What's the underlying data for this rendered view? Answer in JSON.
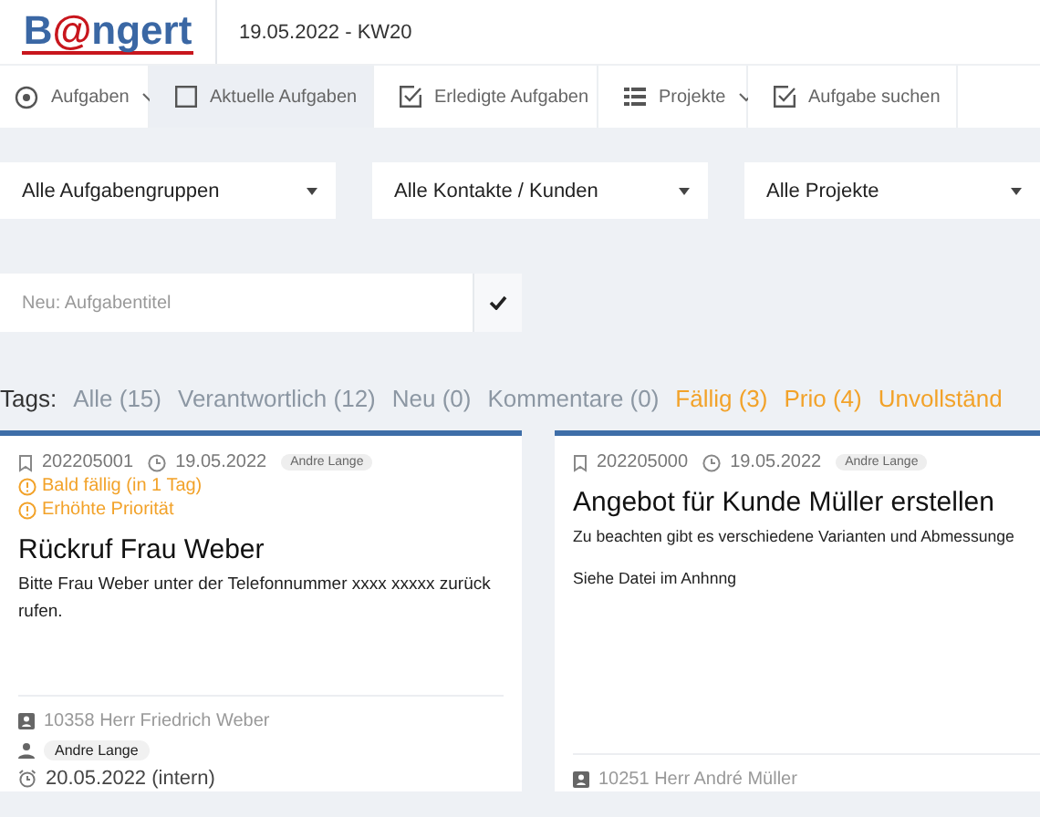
{
  "header": {
    "logo": [
      {
        "text": "B",
        "kind": "plain"
      },
      {
        "text": "@",
        "kind": "accent"
      },
      {
        "text": "ngert",
        "kind": "plain"
      }
    ],
    "date": "19.05.2022 - KW20"
  },
  "nav": [
    {
      "label": "Aufgaben",
      "kind": "radio",
      "dropdown": true,
      "selected": false
    },
    {
      "label": "Aktuelle Aufgaben",
      "kind": "box",
      "dropdown": false,
      "selected": true
    },
    {
      "label": "Erledigte Aufgaben",
      "kind": "check",
      "dropdown": false,
      "selected": false
    },
    {
      "label": "Projekte",
      "kind": "list",
      "dropdown": true,
      "selected": false
    },
    {
      "label": "Aufgabe suchen",
      "kind": "check",
      "dropdown": false,
      "selected": false
    }
  ],
  "filters": [
    {
      "value": "Alle Aufgabengruppen"
    },
    {
      "value": "Alle Kontakte / Kunden"
    },
    {
      "value": "Alle Projekte"
    }
  ],
  "new_task": {
    "placeholder": "Neu: Aufgabentitel"
  },
  "tags": {
    "label": "Tags:",
    "items": [
      {
        "label": "Alle (15)",
        "kind": "normal"
      },
      {
        "label": "Verantwortlich (12)",
        "kind": "normal"
      },
      {
        "label": "Neu (0)",
        "kind": "normal"
      },
      {
        "label": "Kommentare (0)",
        "kind": "normal"
      },
      {
        "label": "Fällig (3)",
        "kind": "warning"
      },
      {
        "label": "Prio (4)",
        "kind": "warning"
      },
      {
        "label": "Unvollständ",
        "kind": "warning"
      }
    ]
  },
  "cards": [
    {
      "number": "202205001",
      "date": "19.05.2022",
      "user": "Andre Lange",
      "warnings": [
        "Bald fällig (in 1 Tag)",
        "Erhöhte Priorität"
      ],
      "title": "Rückruf Frau Weber",
      "description": [
        "Bitte Frau Weber unter der Telefonnummer xxxx xxxxx zurück rufen."
      ],
      "customer": "10358 Herr Friedrich Weber",
      "assignee": "Andre Lange",
      "due": "20.05.2022 (intern)"
    },
    {
      "number": "202205000",
      "date": "19.05.2022",
      "user": "Andre Lange",
      "title": "Angebot für Kunde Müller erstellen",
      "description": [
        "Zu beachten gibt es verschiedene Varianten und Abmessunge",
        "Siehe Datei im Anhnng"
      ],
      "customer": "10251 Herr André Müller"
    }
  ]
}
